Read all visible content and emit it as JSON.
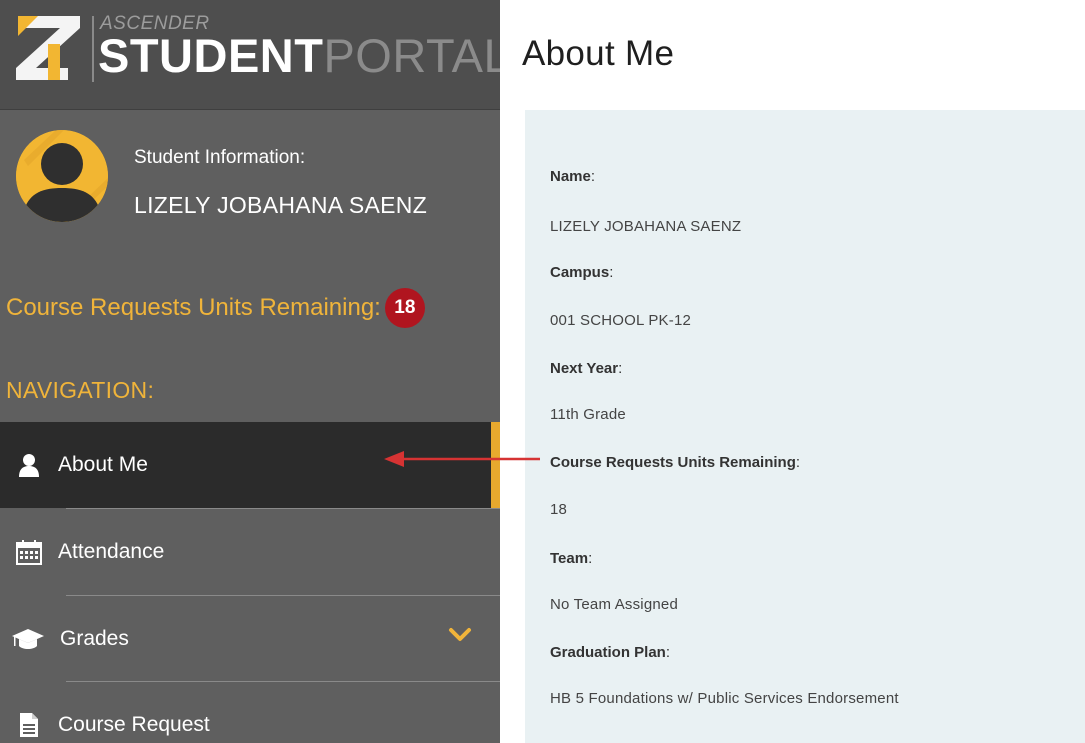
{
  "logo": {
    "small": "ASCENDER",
    "bold": "STUDENT",
    "light": "PORTAL"
  },
  "student": {
    "label": "Student Information:",
    "name": "LIZELY JOBAHANA SAENZ"
  },
  "units": {
    "label": "Course Requests Units Remaining:",
    "count": "18"
  },
  "nav": {
    "heading": "NAVIGATION:",
    "items": [
      {
        "label": "About Me",
        "icon": "user-icon",
        "active": true
      },
      {
        "label": "Attendance",
        "icon": "calendar-icon",
        "active": false
      },
      {
        "label": "Grades",
        "icon": "graduation-cap-icon",
        "active": false
      },
      {
        "label": "Course Request",
        "icon": "document-icon",
        "active": false
      }
    ]
  },
  "page": {
    "title": "About Me"
  },
  "fields": [
    {
      "label": "Name",
      "value": "LIZELY JOBAHANA SAENZ"
    },
    {
      "label": "Campus",
      "value": "001 SCHOOL PK-12"
    },
    {
      "label": "Next Year",
      "value": "11th Grade"
    },
    {
      "label": "Course Requests Units Remaining",
      "value": "18"
    },
    {
      "label": "Team",
      "value": "No Team Assigned"
    },
    {
      "label": "Graduation Plan",
      "value": "HB 5 Foundations w/ Public Services Endorsement"
    }
  ],
  "colors": {
    "accent": "#f0b43a",
    "sidebar": "#5f5f5f",
    "active_bg": "#2b2b2b",
    "badge": "#b0151f",
    "panel": "#e9f1f3",
    "arrow": "#d63333"
  }
}
